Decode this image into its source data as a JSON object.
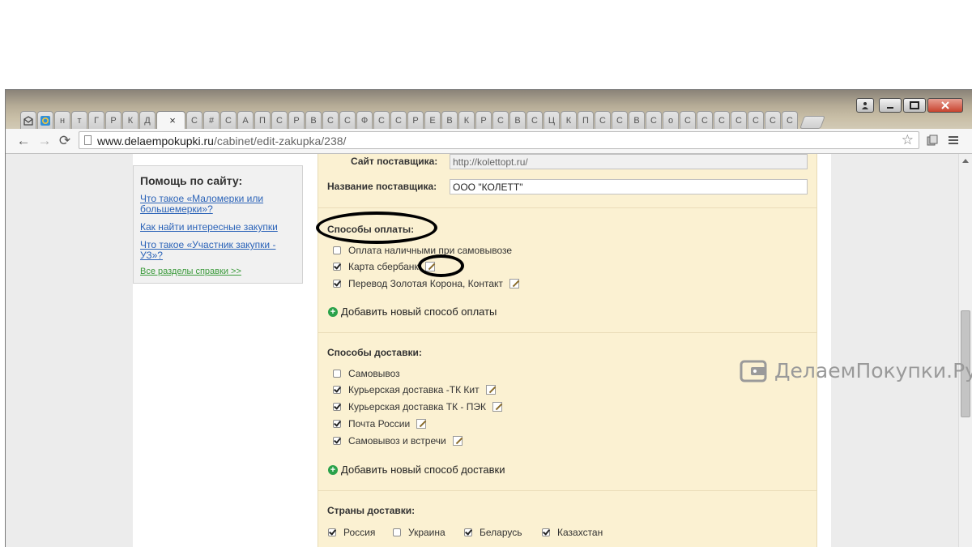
{
  "browser": {
    "tabs": [
      "н",
      "т",
      "Г",
      "Р",
      "К",
      "Д",
      "С",
      "#",
      "С",
      "А",
      "П",
      "С",
      "Р",
      "В",
      "С",
      "С",
      "Ф",
      "С",
      "С",
      "Р",
      "Е",
      "В",
      "К",
      "Р",
      "С",
      "В",
      "С",
      "Ц",
      "К",
      "П",
      "С",
      "С",
      "В",
      "С",
      "о",
      "С",
      "С",
      "С",
      "С",
      "С",
      "С",
      "С"
    ],
    "active_tab_close": "×",
    "url_host": "www.delaempokupki.ru",
    "url_path": "/cabinet/edit-zakupka/238/",
    "back": "←",
    "forward": "→",
    "reload": "⟳",
    "star": "☆"
  },
  "help": {
    "title": "Помощь по сайту:",
    "links": [
      "Что такое «Маломерки или большемерки»?",
      "Как найти интересные закупки",
      "Что такое «Участник закупки - УЗ»?"
    ],
    "all_link": "Все разделы справки >>"
  },
  "supplier": {
    "site_label": "Сайт поставщика:",
    "site_value": "http://kolettopt.ru/",
    "name_label": "Название поставщика:",
    "name_value": "ООО \"КОЛЕТТ\""
  },
  "payment": {
    "title": "Способы оплаты:",
    "items": [
      {
        "label": "Оплата наличными при самовывозе",
        "checked": false
      },
      {
        "label": "Карта сбербанк",
        "checked": true
      },
      {
        "label": "Перевод Золотая Корона, Контакт",
        "checked": true
      }
    ],
    "add_label": "Добавить новый способ оплаты"
  },
  "delivery": {
    "title": "Способы доставки:",
    "items": [
      {
        "label": "Самовывоз",
        "checked": false
      },
      {
        "label": "Курьерская доставка -ТК Кит",
        "checked": true
      },
      {
        "label": "Курьерская доставка ТК - ПЭК",
        "checked": true
      },
      {
        "label": "Почта России",
        "checked": true
      },
      {
        "label": "Самовывоз и встречи",
        "checked": true
      }
    ],
    "add_label": "Добавить новый способ доставки"
  },
  "countries": {
    "title": "Страны доставки:",
    "items": [
      {
        "label": "Россия",
        "checked": true
      },
      {
        "label": "Украина",
        "checked": false
      },
      {
        "label": "Беларусь",
        "checked": true
      },
      {
        "label": "Казахстан",
        "checked": true
      }
    ]
  },
  "watermark": {
    "text": "ДелаемПокупки.Ру"
  }
}
